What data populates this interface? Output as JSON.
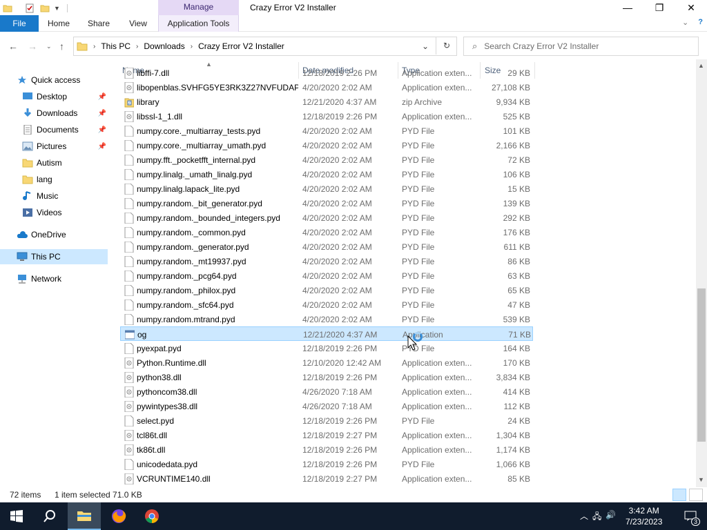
{
  "window": {
    "title": "Crazy Error V2 Installer",
    "context_tab": "Manage",
    "minimize": "—",
    "maximize": "❐",
    "close": "✕"
  },
  "ribbon": {
    "tabs": [
      "File",
      "Home",
      "Share",
      "View",
      "Application Tools"
    ]
  },
  "address": {
    "crumbs": [
      "This PC",
      "Downloads",
      "Crazy Error V2 Installer"
    ],
    "search_placeholder": "Search Crazy Error V2 Installer"
  },
  "nav": {
    "items": [
      {
        "label": "Quick access",
        "icon": "star-icon",
        "pinned": false
      },
      {
        "label": "Desktop",
        "icon": "desktop-icon",
        "pinned": true
      },
      {
        "label": "Downloads",
        "icon": "download-icon",
        "pinned": true
      },
      {
        "label": "Documents",
        "icon": "document-icon",
        "pinned": true
      },
      {
        "label": "Pictures",
        "icon": "picture-icon",
        "pinned": true
      },
      {
        "label": "Autism",
        "icon": "folder-icon",
        "pinned": false
      },
      {
        "label": "lang",
        "icon": "folder-icon",
        "pinned": false
      },
      {
        "label": "Music",
        "icon": "music-icon",
        "pinned": false
      },
      {
        "label": "Videos",
        "icon": "video-icon",
        "pinned": false
      },
      {
        "label": "OneDrive",
        "icon": "cloud-icon",
        "pinned": false
      },
      {
        "label": "This PC",
        "icon": "computer-icon",
        "pinned": false,
        "selected": true
      },
      {
        "label": "Network",
        "icon": "network-icon",
        "pinned": false
      }
    ]
  },
  "columns": {
    "name": "Name",
    "date": "Date modified",
    "type": "Type",
    "size": "Size"
  },
  "files": [
    {
      "name": "libffi-7.dll",
      "date": "12/18/2019 2:26 PM",
      "type": "Application exten...",
      "size": "29 KB",
      "icon": "dll-icon"
    },
    {
      "name": "libopenblas.SVHFG5YE3RK3Z27NVFUDAP...",
      "date": "4/20/2020 2:02 AM",
      "type": "Application exten...",
      "size": "27,108 KB",
      "icon": "dll-icon"
    },
    {
      "name": "library",
      "date": "12/21/2020 4:37 AM",
      "type": "zip Archive",
      "size": "9,934 KB",
      "icon": "zip-icon"
    },
    {
      "name": "libssl-1_1.dll",
      "date": "12/18/2019 2:26 PM",
      "type": "Application exten...",
      "size": "525 KB",
      "icon": "dll-icon"
    },
    {
      "name": "numpy.core._multiarray_tests.pyd",
      "date": "4/20/2020 2:02 AM",
      "type": "PYD File",
      "size": "101 KB",
      "icon": "file-icon"
    },
    {
      "name": "numpy.core._multiarray_umath.pyd",
      "date": "4/20/2020 2:02 AM",
      "type": "PYD File",
      "size": "2,166 KB",
      "icon": "file-icon"
    },
    {
      "name": "numpy.fft._pocketfft_internal.pyd",
      "date": "4/20/2020 2:02 AM",
      "type": "PYD File",
      "size": "72 KB",
      "icon": "file-icon"
    },
    {
      "name": "numpy.linalg._umath_linalg.pyd",
      "date": "4/20/2020 2:02 AM",
      "type": "PYD File",
      "size": "106 KB",
      "icon": "file-icon"
    },
    {
      "name": "numpy.linalg.lapack_lite.pyd",
      "date": "4/20/2020 2:02 AM",
      "type": "PYD File",
      "size": "15 KB",
      "icon": "file-icon"
    },
    {
      "name": "numpy.random._bit_generator.pyd",
      "date": "4/20/2020 2:02 AM",
      "type": "PYD File",
      "size": "139 KB",
      "icon": "file-icon"
    },
    {
      "name": "numpy.random._bounded_integers.pyd",
      "date": "4/20/2020 2:02 AM",
      "type": "PYD File",
      "size": "292 KB",
      "icon": "file-icon"
    },
    {
      "name": "numpy.random._common.pyd",
      "date": "4/20/2020 2:02 AM",
      "type": "PYD File",
      "size": "176 KB",
      "icon": "file-icon"
    },
    {
      "name": "numpy.random._generator.pyd",
      "date": "4/20/2020 2:02 AM",
      "type": "PYD File",
      "size": "611 KB",
      "icon": "file-icon"
    },
    {
      "name": "numpy.random._mt19937.pyd",
      "date": "4/20/2020 2:02 AM",
      "type": "PYD File",
      "size": "86 KB",
      "icon": "file-icon"
    },
    {
      "name": "numpy.random._pcg64.pyd",
      "date": "4/20/2020 2:02 AM",
      "type": "PYD File",
      "size": "63 KB",
      "icon": "file-icon"
    },
    {
      "name": "numpy.random._philox.pyd",
      "date": "4/20/2020 2:02 AM",
      "type": "PYD File",
      "size": "65 KB",
      "icon": "file-icon"
    },
    {
      "name": "numpy.random._sfc64.pyd",
      "date": "4/20/2020 2:02 AM",
      "type": "PYD File",
      "size": "47 KB",
      "icon": "file-icon"
    },
    {
      "name": "numpy.random.mtrand.pyd",
      "date": "4/20/2020 2:02 AM",
      "type": "PYD File",
      "size": "539 KB",
      "icon": "file-icon"
    },
    {
      "name": "og",
      "date": "12/21/2020 4:37 AM",
      "type": "Application",
      "size": "71 KB",
      "icon": "app-icon",
      "selected": true
    },
    {
      "name": "pyexpat.pyd",
      "date": "12/18/2019 2:26 PM",
      "type": "PYD File",
      "size": "164 KB",
      "icon": "file-icon"
    },
    {
      "name": "Python.Runtime.dll",
      "date": "12/10/2020 12:42 AM",
      "type": "Application exten...",
      "size": "170 KB",
      "icon": "dll-icon"
    },
    {
      "name": "python38.dll",
      "date": "12/18/2019 2:26 PM",
      "type": "Application exten...",
      "size": "3,834 KB",
      "icon": "dll-icon"
    },
    {
      "name": "pythoncom38.dll",
      "date": "4/26/2020 7:18 AM",
      "type": "Application exten...",
      "size": "414 KB",
      "icon": "dll-icon"
    },
    {
      "name": "pywintypes38.dll",
      "date": "4/26/2020 7:18 AM",
      "type": "Application exten...",
      "size": "112 KB",
      "icon": "dll-icon"
    },
    {
      "name": "select.pyd",
      "date": "12/18/2019 2:26 PM",
      "type": "PYD File",
      "size": "24 KB",
      "icon": "file-icon"
    },
    {
      "name": "tcl86t.dll",
      "date": "12/18/2019 2:27 PM",
      "type": "Application exten...",
      "size": "1,304 KB",
      "icon": "dll-icon"
    },
    {
      "name": "tk86t.dll",
      "date": "12/18/2019 2:26 PM",
      "type": "Application exten...",
      "size": "1,174 KB",
      "icon": "dll-icon"
    },
    {
      "name": "unicodedata.pyd",
      "date": "12/18/2019 2:26 PM",
      "type": "PYD File",
      "size": "1,066 KB",
      "icon": "file-icon"
    },
    {
      "name": "VCRUNTIME140.dll",
      "date": "12/18/2019 2:27 PM",
      "type": "Application exten...",
      "size": "85 KB",
      "icon": "dll-icon"
    }
  ],
  "status": {
    "count": "72 items",
    "selection": "1 item selected  71.0 KB"
  },
  "taskbar": {
    "time": "3:42 AM",
    "date": "7/23/2023",
    "notifications": "3"
  },
  "colors": {
    "accent": "#1979ca",
    "selection": "#cce8ff",
    "taskbar": "#101c2d"
  }
}
